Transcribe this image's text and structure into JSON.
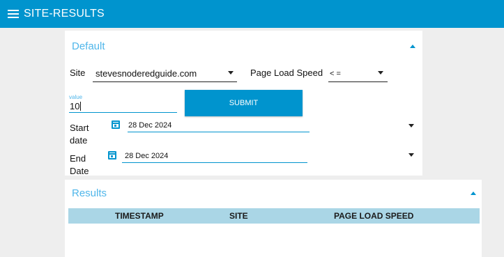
{
  "app": {
    "title": "SITE-RESULTS",
    "menu_icon": "hamburger-menu-icon"
  },
  "colors": {
    "accent": "#0094ce",
    "header_text": "#4fb6ea",
    "table_header_bg": "#aad6e6",
    "background": "#eeeeee"
  },
  "default_group": {
    "title": "Default",
    "site_label": "Site",
    "site_value": "stevesnoderedguide.com",
    "metric_label": "Page Load Speed",
    "operator_value": "< =",
    "value_label": "value",
    "value_input": "10",
    "submit_label": "SUBMIT",
    "start_date_label": "Start\ndate",
    "start_date_value": "28 Dec 2024",
    "end_date_label": "End\nDate",
    "end_date_value": "28 Dec 2024"
  },
  "results_group": {
    "title": "Results",
    "columns": [
      "TIMESTAMP",
      "SITE",
      "PAGE LOAD SPEED"
    ],
    "rows": []
  }
}
